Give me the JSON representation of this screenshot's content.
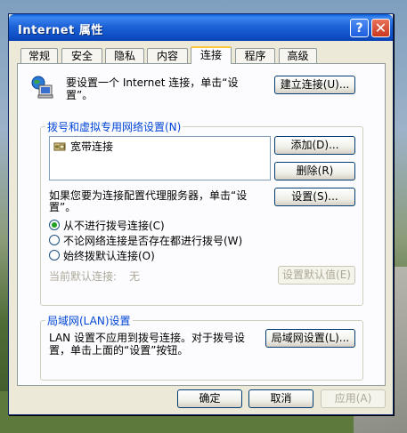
{
  "window": {
    "title": "Internet 属性",
    "help_label": "?",
    "close_label": "✕"
  },
  "tabs": [
    {
      "label": "常规"
    },
    {
      "label": "安全"
    },
    {
      "label": "隐私"
    },
    {
      "label": "内容"
    },
    {
      "label": "连接"
    },
    {
      "label": "程序"
    },
    {
      "label": "高级"
    }
  ],
  "active_tab": "连接",
  "setup": {
    "text_line1": "要设置一个 Internet 连接，单击“设",
    "text_line2": "置”。",
    "button": "建立连接(U)..."
  },
  "dialup": {
    "group_title": "拨号和虚拟专用网络设置(N)",
    "connections": [
      {
        "name": "宽带连接"
      }
    ],
    "add_button": "添加(D)...",
    "remove_button": "删除(R)",
    "settings_button": "设置(S)...",
    "proxy_text_line1": "如果您要为连接配置代理服务器，单击“设",
    "proxy_text_line2": "置”。",
    "options": [
      {
        "label": "从不进行拨号连接(C)",
        "checked": true
      },
      {
        "label": "不论网络连接是否存在都进行拨号(W)",
        "checked": false
      },
      {
        "label": "始终拨默认连接(O)",
        "checked": false
      }
    ],
    "current_default_label": "当前默认连接:",
    "current_default_value": "无",
    "set_default_button": "设置默认值(E)"
  },
  "lan": {
    "group_title": "局域网(LAN)设置",
    "text_line1": "LAN 设置不应用到拨号连接。对于拨号设",
    "text_line2": "置，单击上面的“设置”按钮。",
    "button": "局域网设置(L)..."
  },
  "footer": {
    "ok": "确定",
    "cancel": "取消",
    "apply": "应用(A)"
  }
}
